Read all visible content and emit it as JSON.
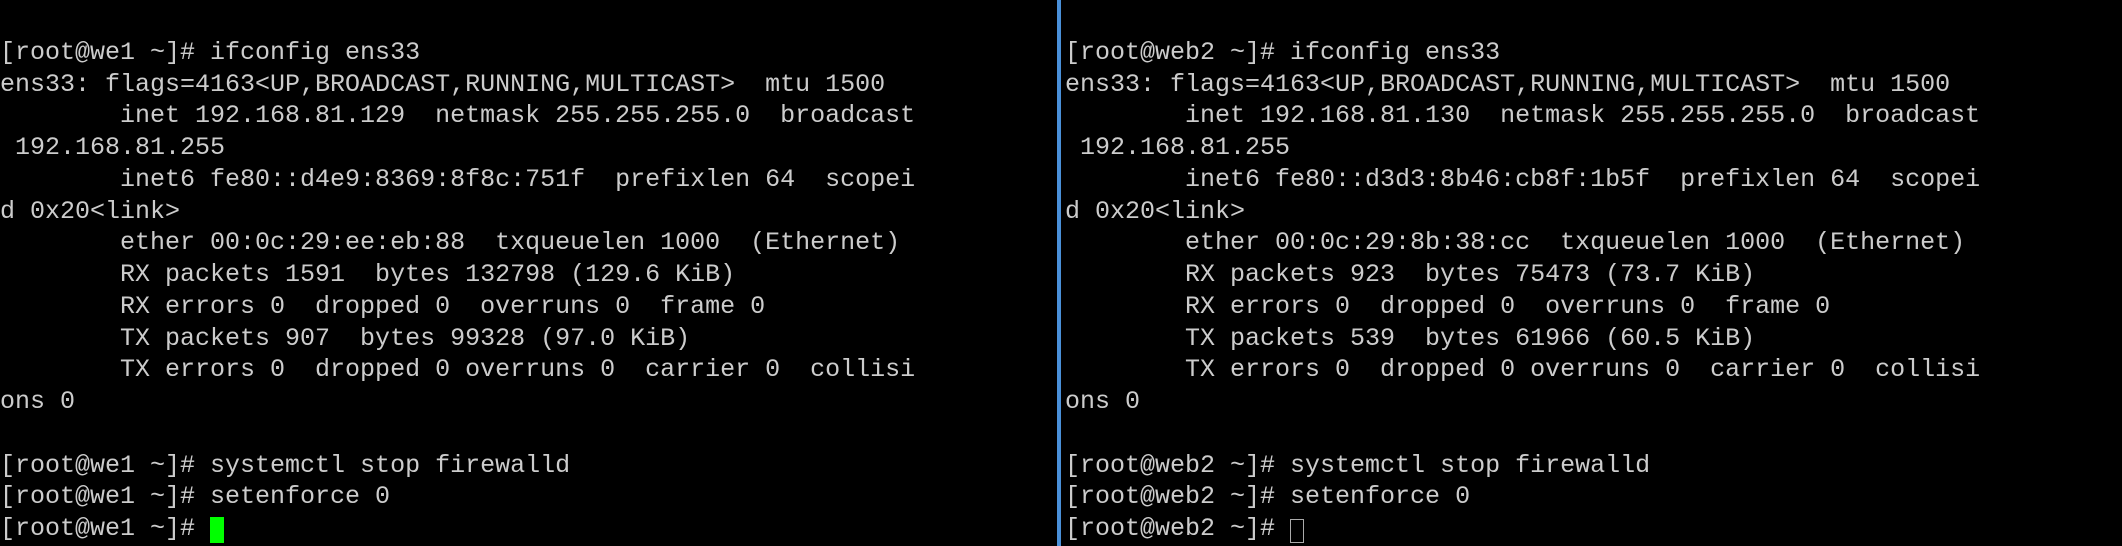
{
  "left": {
    "host": "we1",
    "prompt1": "[root@we1 ~]# ifconfig ens33",
    "line1": "ens33: flags=4163<UP,BROADCAST,RUNNING,MULTICAST>  mtu 1500",
    "line2": "        inet 192.168.81.129  netmask 255.255.255.0  broadcast",
    "line3": " 192.168.81.255",
    "line4": "        inet6 fe80::d4e9:8369:8f8c:751f  prefixlen 64  scopei",
    "line5": "d 0x20<link>",
    "line6": "        ether 00:0c:29:ee:eb:88  txqueuelen 1000  (Ethernet)",
    "line7": "        RX packets 1591  bytes 132798 (129.6 KiB)",
    "line8": "        RX errors 0  dropped 0  overruns 0  frame 0",
    "line9": "        TX packets 907  bytes 99328 (97.0 KiB)",
    "line10": "        TX errors 0  dropped 0 overruns 0  carrier 0  collisi",
    "line11": "ons 0",
    "blank": "",
    "prompt2": "[root@we1 ~]# systemctl stop firewalld",
    "prompt3": "[root@we1 ~]# setenforce 0",
    "prompt4": "[root@we1 ~]# "
  },
  "right": {
    "host": "web2",
    "prompt1": "[root@web2 ~]# ifconfig ens33",
    "line1": "ens33: flags=4163<UP,BROADCAST,RUNNING,MULTICAST>  mtu 1500",
    "line2": "        inet 192.168.81.130  netmask 255.255.255.0  broadcast",
    "line3": " 192.168.81.255",
    "line4": "        inet6 fe80::d3d3:8b46:cb8f:1b5f  prefixlen 64  scopei",
    "line5": "d 0x20<link>",
    "line6": "        ether 00:0c:29:8b:38:cc  txqueuelen 1000  (Ethernet)",
    "line7": "        RX packets 923  bytes 75473 (73.7 KiB)",
    "line8": "        RX errors 0  dropped 0  overruns 0  frame 0",
    "line9": "        TX packets 539  bytes 61966 (60.5 KiB)",
    "line10": "        TX errors 0  dropped 0 overruns 0  carrier 0  collisi",
    "line11": "ons 0",
    "blank": "",
    "prompt2": "[root@web2 ~]# systemctl stop firewalld",
    "prompt3": "[root@web2 ~]# setenforce 0",
    "prompt4": "[root@web2 ~]# "
  }
}
